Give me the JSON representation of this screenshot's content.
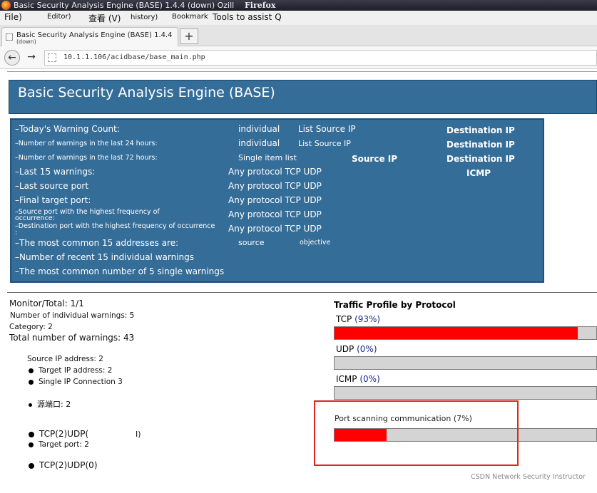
{
  "window": {
    "title": "Basic Security Analysis Engine (BASE) 1.4.4 (down) Ozill",
    "brand": "Firefox"
  },
  "menu": [
    "File)",
    "Editor)",
    "查看 (V)",
    "history)",
    "Bookmark",
    "Tools to assist Q"
  ],
  "tab": {
    "title": "Basic Security Analysis Engine (BASE) 1.4.4",
    "subtitle": "(down)",
    "new_tab": "+"
  },
  "nav": {
    "back": "←",
    "forward": "→",
    "url": "10.1.1.106/acidbase/base_main.php"
  },
  "banner": {
    "title": "Basic Security Analysis Engine (BASE)"
  },
  "panel": {
    "rows": [
      {
        "label": "–Today's Warning Count:",
        "c1": "individual",
        "c2": "List Source IP",
        "c3": "",
        "c4": "Destination IP"
      },
      {
        "label": "–Number of warnings in the last 24 hours:",
        "c1": "individual",
        "c2": "List Source IP",
        "c3": "",
        "c4": "Destination IP"
      },
      {
        "label": "–Number of warnings in the last 72 hours:",
        "c1": "Single item list",
        "c2": "",
        "c3": "Source IP",
        "c4": "Destination IP"
      },
      {
        "label": "–Last 15 warnings:",
        "c1": "Any protocol TCP UDP",
        "c2": "",
        "c3": "",
        "c4": "ICMP"
      },
      {
        "label": "–Last source port",
        "c1": "Any protocol TCP UDP"
      },
      {
        "label": "–Final target port:",
        "c1": "Any protocol TCP UDP"
      },
      {
        "label": "–Source port with the highest frequency of",
        "label2": "occurrence:",
        "c1": "Any protocol TCP UDP"
      },
      {
        "label": "–Destination port with the highest frequency of occurrence",
        "label2": ":",
        "c1": "Any protocol TCP UDP"
      },
      {
        "label": "–The most common 15 addresses are:",
        "c1": "source",
        "c2": "objective"
      },
      {
        "label": "–Number of recent 15 individual warnings"
      },
      {
        "label": "–The most common number of 5 single warnings"
      }
    ]
  },
  "stats": {
    "monitor": "Monitor/Total: 1/1",
    "individual": "Number of individual warnings: 5",
    "category": "Category: 2",
    "total": "Total number of warnings: 43",
    "source_ip": "Source IP address: 2",
    "target_ip": "Target IP address: 2",
    "single_conn": "Single IP Connection 3",
    "src_port_label": "源端口:",
    "src_port_value": "2",
    "tcpudp1": "TCP(2)UDP(",
    "tcpudp1_tail": "I)",
    "target_port": "Target port: 2",
    "tcpudp2": "TCP(2)UDP(0)"
  },
  "traffic": {
    "title": "Traffic Profile by Protocol",
    "tcp_label": "TCP",
    "tcp_pct": "(93%)",
    "tcp_value": 0.93,
    "udp_label": "UDP",
    "udp_pct": "(0%)",
    "udp_value": 0.0,
    "icmp_label": "ICMP",
    "icmp_pct": "(0%)",
    "icmp_value": 0.0,
    "portscan_label": "Port scanning communication (7%)",
    "portscan_value": 0.07
  },
  "footer": {
    "watermark": "CSDN Network Security Instructor"
  }
}
